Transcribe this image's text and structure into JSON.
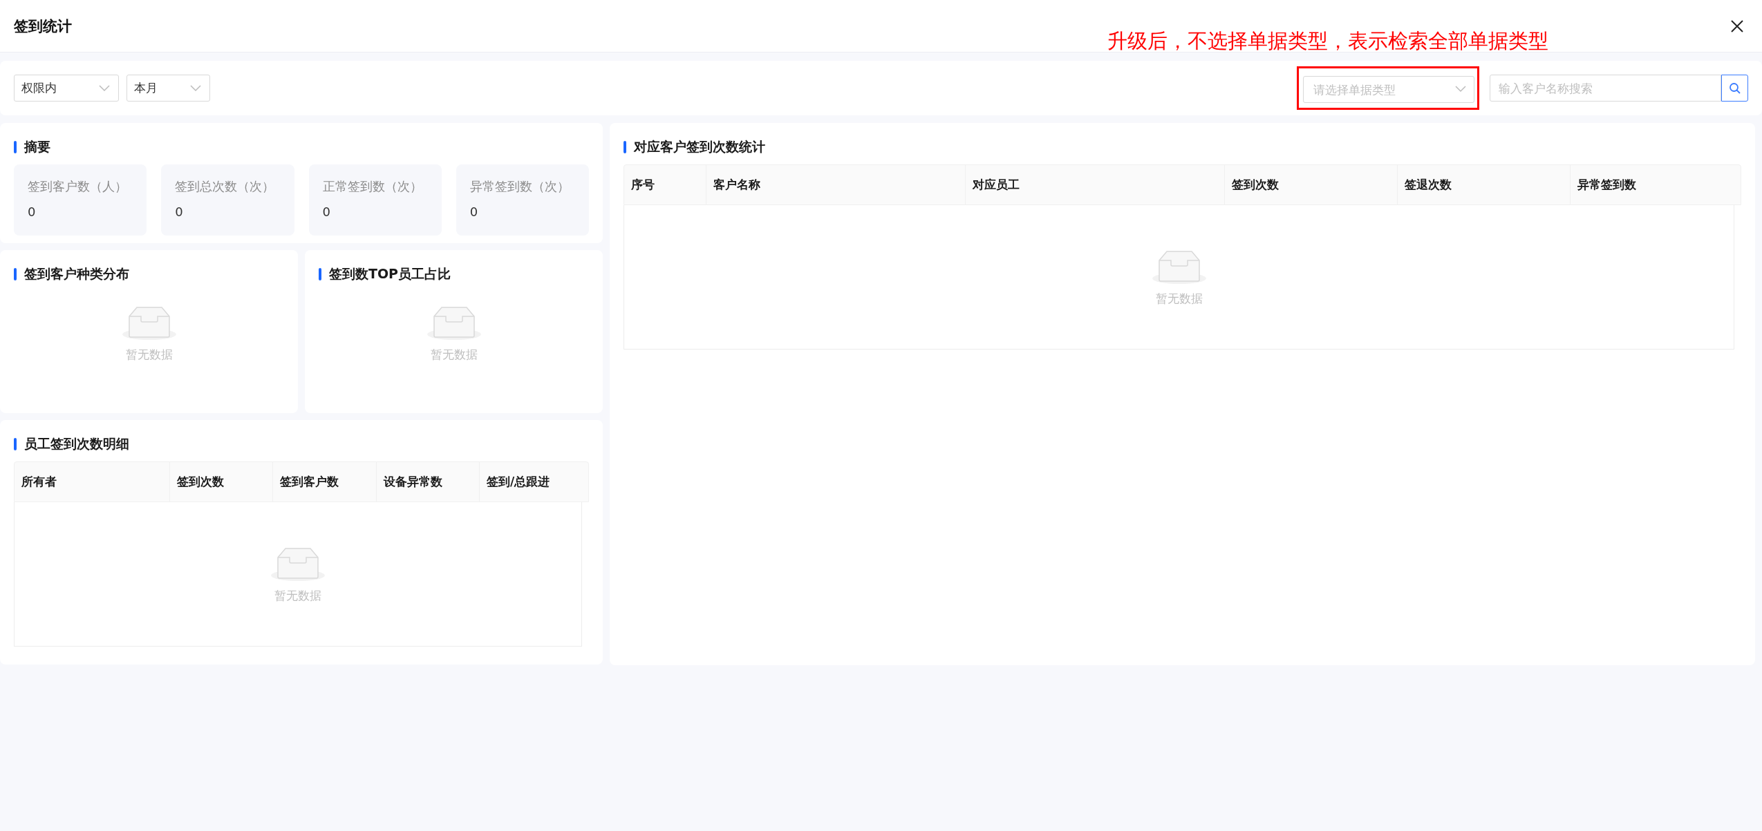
{
  "header": {
    "title": "签到统计"
  },
  "annotation": {
    "text": "升级后，不选择单据类型，表示检索全部单据类型"
  },
  "filters": {
    "scope": {
      "value": "权限内"
    },
    "period": {
      "value": "本月"
    },
    "doc_type": {
      "placeholder": "请选择单据类型",
      "highlighted": true
    },
    "search": {
      "placeholder": "输入客户名称搜索"
    }
  },
  "summary": {
    "title": "摘要",
    "stats": [
      {
        "label": "签到客户数（人）",
        "value": "0"
      },
      {
        "label": "签到总次数（次）",
        "value": "0"
      },
      {
        "label": "正常签到数（次）",
        "value": "0"
      },
      {
        "label": "异常签到数（次）",
        "value": "0"
      }
    ]
  },
  "charts": [
    {
      "title": "签到客户种类分布",
      "empty_text": "暂无数据"
    },
    {
      "title": "签到数TOP员工占比",
      "empty_text": "暂无数据"
    }
  ],
  "employee_table": {
    "title": "员工签到次数明细",
    "columns": [
      "所有者",
      "签到次数",
      "签到客户数",
      "设备异常数",
      "签到/总跟进"
    ],
    "empty_text": "暂无数据"
  },
  "customer_table": {
    "title": "对应客户签到次数统计",
    "columns": [
      "序号",
      "客户名称",
      "对应员工",
      "签到次数",
      "签退次数",
      "异常签到数"
    ],
    "empty_text": "暂无数据"
  }
}
